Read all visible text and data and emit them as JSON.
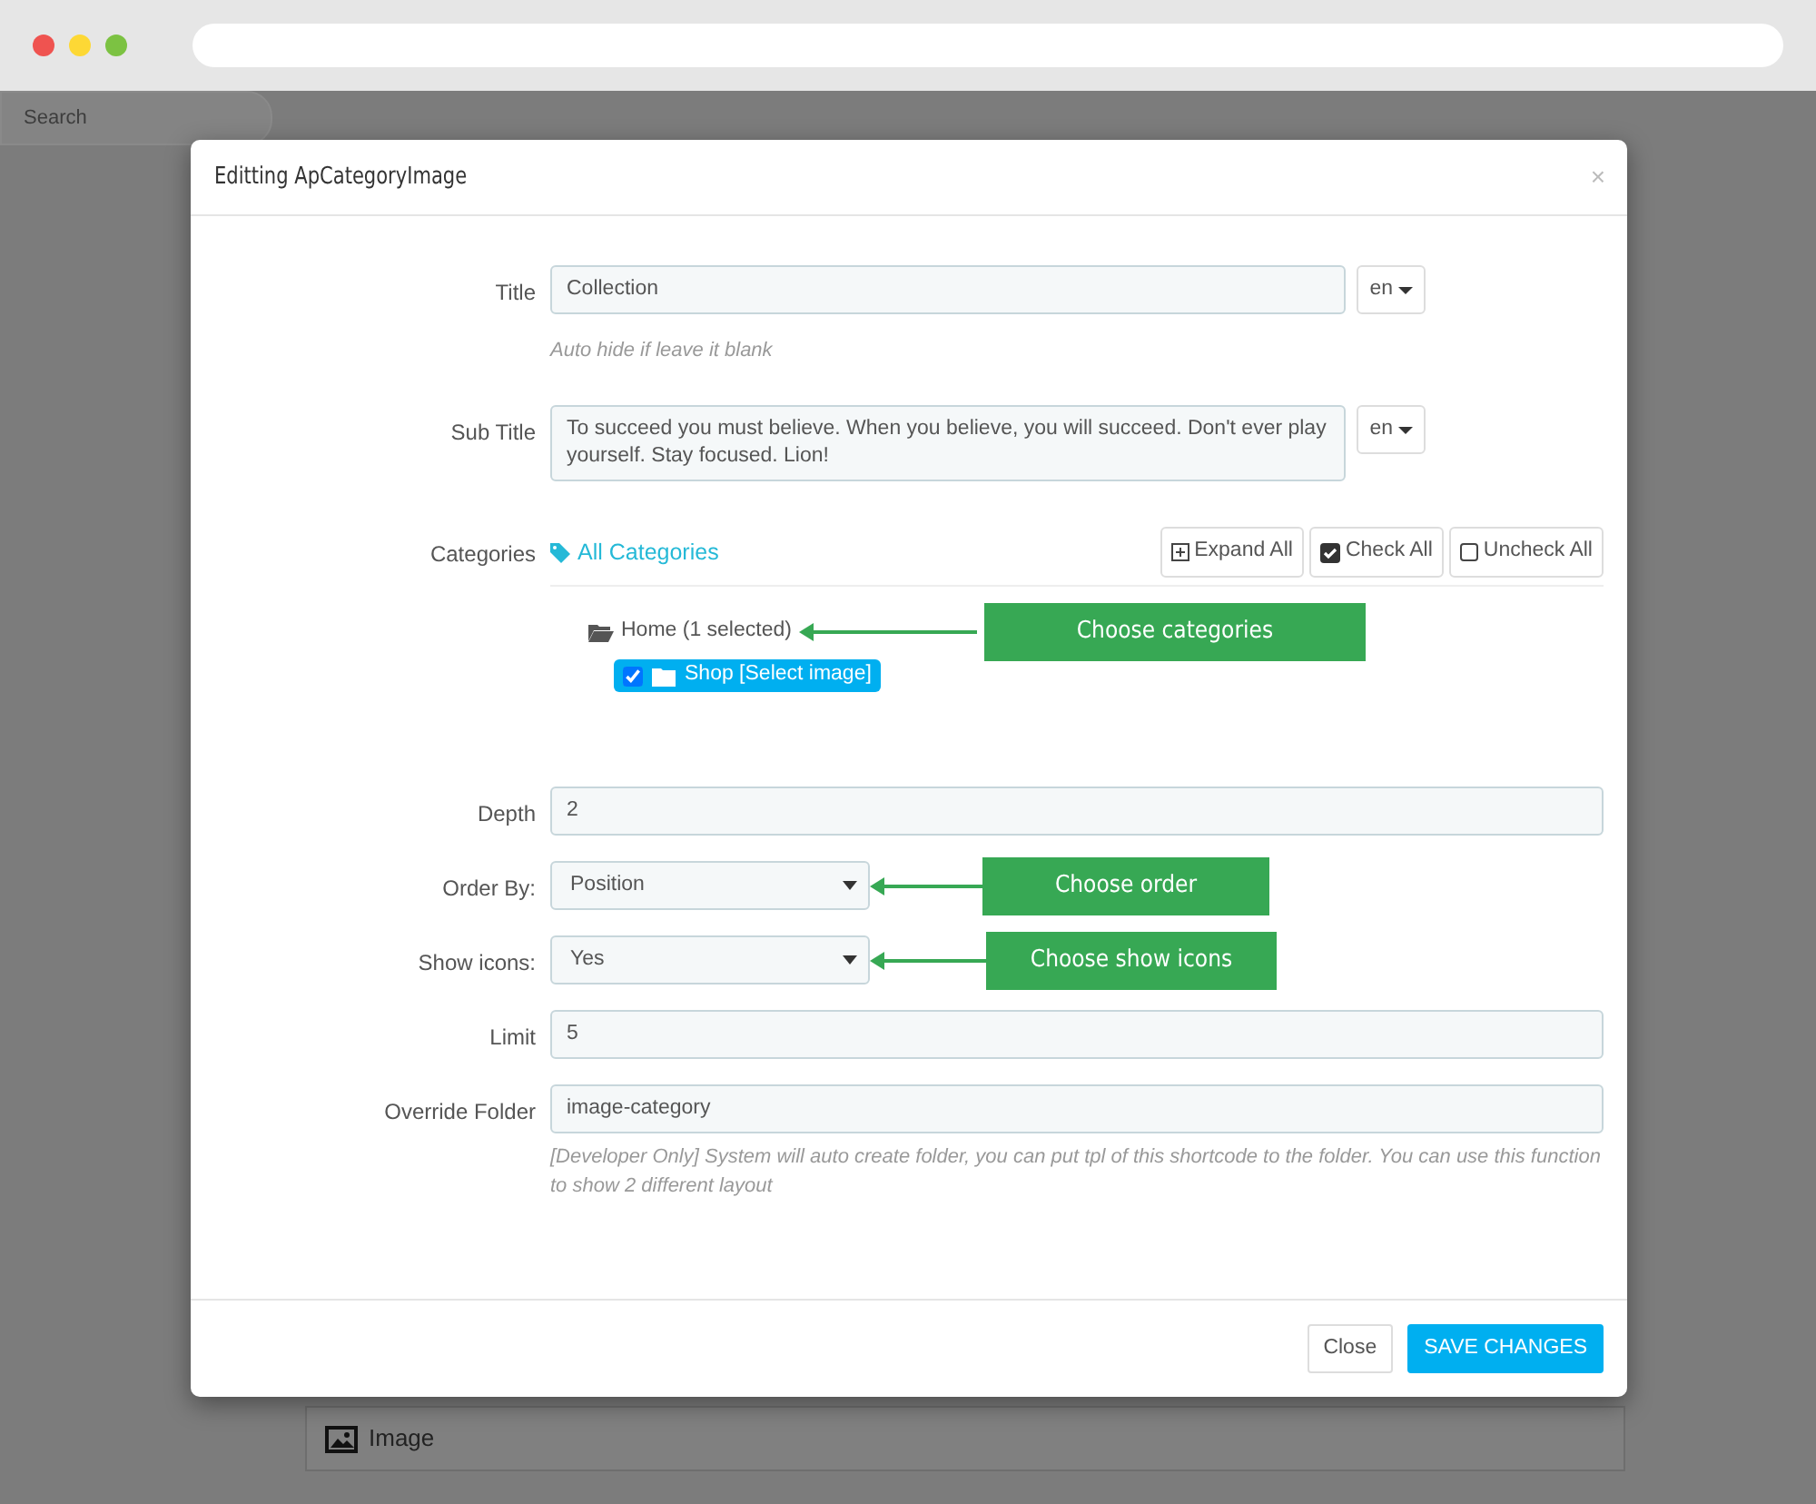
{
  "background": {
    "search": {
      "placeholder": "Search"
    },
    "image_panel": {
      "label": "Image"
    }
  },
  "modal": {
    "title": "Editting ApCategoryImage",
    "close": "×",
    "fields": [
      {
        "kind": "text",
        "label": "Title",
        "value": "Collection",
        "lang": "en",
        "help": "Auto hide if leave it blank"
      },
      {
        "kind": "textarea",
        "label": "Sub Title",
        "value": "To succeed you must believe. When you believe, you will succeed. Don't ever play yourself. Stay focused. Lion!",
        "lang": "en"
      },
      {
        "kind": "categories",
        "label": "Categories",
        "link": "All Categories",
        "buttons": [
          {
            "kind": "expand",
            "label": "Expand All"
          },
          {
            "kind": "check",
            "label": "Check All"
          },
          {
            "kind": "uncheck",
            "label": "Uncheck All"
          }
        ],
        "tree": [
          {
            "label": "Home (1 selected)",
            "expanded": true,
            "callout": "Choose categories",
            "children": [
              {
                "label": "Shop [Select image]",
                "checked": true,
                "selected": true
              }
            ]
          }
        ]
      },
      {
        "kind": "input",
        "label": "Depth",
        "value": "2"
      },
      {
        "kind": "select",
        "label": "Order By:",
        "value": "Position",
        "callout": "Choose order"
      },
      {
        "kind": "select",
        "label": "Show icons:",
        "value": "Yes",
        "callout": "Choose show icons"
      },
      {
        "kind": "input",
        "label": "Limit",
        "value": "5"
      },
      {
        "kind": "input",
        "label": "Override Folder",
        "value": "image-category",
        "help": "[Developer Only] System will auto create folder, you can put tpl of this shortcode to the folder. You can use this function to show 2 different layout"
      }
    ],
    "buttons": [
      {
        "kind": "secondary",
        "label": "Close"
      },
      {
        "kind": "primary",
        "label": "SAVE CHANGES"
      }
    ]
  }
}
